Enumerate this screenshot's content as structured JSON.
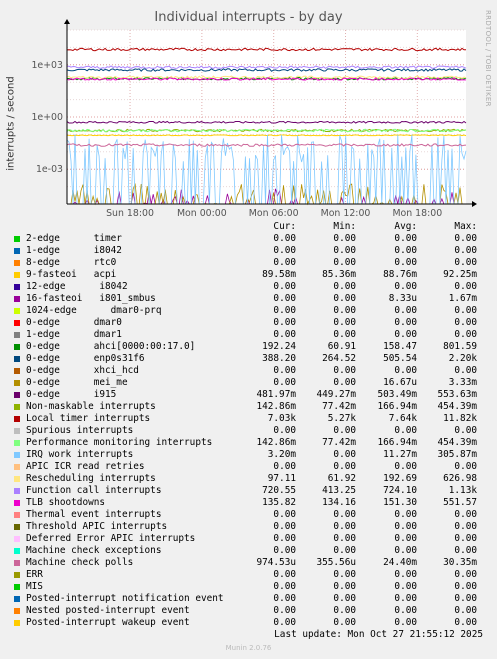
{
  "title": "Individual interrupts - by day",
  "side_text": "RRDTOOL / TOBI OETIKER",
  "ylabel": "interrupts / second",
  "last_update": "Last update: Mon Oct 27 21:55:12 2025",
  "munin_version": "Munin 2.0.76",
  "legend_headers": {
    "cur": "Cur:",
    "min": "Min:",
    "avg": "Avg:",
    "max": "Max:"
  },
  "chart_data": {
    "type": "line",
    "title": "Individual interrupts - by day",
    "ylabel": "interrupts / second",
    "y_scale": "log",
    "ylim": [
      1e-05,
      100000
    ],
    "y_ticks": [
      {
        "value": 1000,
        "label": "1e+03"
      },
      {
        "value": 1,
        "label": "1e+00"
      },
      {
        "value": 0.001,
        "label": "1e-03"
      }
    ],
    "x_ticks": [
      "Sun 18:00",
      "Mon 00:00",
      "Mon 06:00",
      "Mon 12:00",
      "Mon 18:00"
    ],
    "grid": true,
    "series": [
      {
        "name": "2-edge timer",
        "color": "#00cc00",
        "cur": "0.00",
        "min": "0.00",
        "avg": "0.00",
        "max": "0.00"
      },
      {
        "name": "1-edge i8042",
        "color": "#0066b3",
        "cur": "0.00",
        "min": "0.00",
        "avg": "0.00",
        "max": "0.00"
      },
      {
        "name": "8-edge rtc0",
        "color": "#ff8000",
        "cur": "0.00",
        "min": "0.00",
        "avg": "0.00",
        "max": "0.00"
      },
      {
        "name": "9-fasteoi acpi",
        "color": "#ffcc00",
        "cur": "89.58m",
        "min": "85.36m",
        "avg": "88.76m",
        "max": "92.25m"
      },
      {
        "name": "12-edge i8042",
        "color": "#330099",
        "cur": "0.00",
        "min": "0.00",
        "avg": "0.00",
        "max": "0.00"
      },
      {
        "name": "16-fasteoi i801_smbus",
        "color": "#990099",
        "cur": "0.00",
        "min": "0.00",
        "avg": "8.33u",
        "max": "1.67m"
      },
      {
        "name": "1024-edge dmar0-prq",
        "color": "#ccff00",
        "cur": "0.00",
        "min": "0.00",
        "avg": "0.00",
        "max": "0.00"
      },
      {
        "name": "0-edge dmar0",
        "color": "#ff0000",
        "cur": "0.00",
        "min": "0.00",
        "avg": "0.00",
        "max": "0.00"
      },
      {
        "name": "1-edge dmar1",
        "color": "#808080",
        "cur": "0.00",
        "min": "0.00",
        "avg": "0.00",
        "max": "0.00"
      },
      {
        "name": "0-edge ahci[0000:00:17.0]",
        "color": "#008f00",
        "cur": "192.24",
        "min": "60.91",
        "avg": "158.47",
        "max": "801.59"
      },
      {
        "name": "0-edge enp0s31f6",
        "color": "#00487d",
        "cur": "388.20",
        "min": "264.52",
        "avg": "505.54",
        "max": "2.20k"
      },
      {
        "name": "0-edge xhci_hcd",
        "color": "#b35a00",
        "cur": "0.00",
        "min": "0.00",
        "avg": "0.00",
        "max": "0.00"
      },
      {
        "name": "0-edge mei_me",
        "color": "#b38f00",
        "cur": "0.00",
        "min": "0.00",
        "avg": "16.67u",
        "max": "3.33m"
      },
      {
        "name": "0-edge i915",
        "color": "#6b006b",
        "cur": "481.97m",
        "min": "449.27m",
        "avg": "503.49m",
        "max": "553.63m"
      },
      {
        "name": "Non-maskable interrupts",
        "color": "#8fb300",
        "cur": "142.86m",
        "min": "77.42m",
        "avg": "166.94m",
        "max": "454.39m"
      },
      {
        "name": "Local timer interrupts",
        "color": "#b30000",
        "cur": "7.03k",
        "min": "5.27k",
        "avg": "7.64k",
        "max": "11.82k"
      },
      {
        "name": "Spurious interrupts",
        "color": "#bebebe",
        "cur": "0.00",
        "min": "0.00",
        "avg": "0.00",
        "max": "0.00"
      },
      {
        "name": "Performance monitoring interrupts",
        "color": "#80ff80",
        "cur": "142.86m",
        "min": "77.42m",
        "avg": "166.94m",
        "max": "454.39m"
      },
      {
        "name": "IRQ work interrupts",
        "color": "#80c9ff",
        "cur": "3.20m",
        "min": "0.00",
        "avg": "11.27m",
        "max": "305.87m"
      },
      {
        "name": "APIC ICR read retries",
        "color": "#ffc080",
        "cur": "0.00",
        "min": "0.00",
        "avg": "0.00",
        "max": "0.00"
      },
      {
        "name": "Rescheduling interrupts",
        "color": "#ffe680",
        "cur": "97.11",
        "min": "61.92",
        "avg": "192.69",
        "max": "626.98"
      },
      {
        "name": "Function call interrupts",
        "color": "#aa80ff",
        "cur": "720.55",
        "min": "413.25",
        "avg": "724.10",
        "max": "1.13k"
      },
      {
        "name": "TLB shootdowns",
        "color": "#ee00cc",
        "cur": "135.82",
        "min": "134.16",
        "avg": "151.30",
        "max": "551.57"
      },
      {
        "name": "Thermal event interrupts",
        "color": "#ff8080",
        "cur": "0.00",
        "min": "0.00",
        "avg": "0.00",
        "max": "0.00"
      },
      {
        "name": "Threshold APIC interrupts",
        "color": "#666600",
        "cur": "0.00",
        "min": "0.00",
        "avg": "0.00",
        "max": "0.00"
      },
      {
        "name": "Deferred Error APIC interrupts",
        "color": "#ffbfff",
        "cur": "0.00",
        "min": "0.00",
        "avg": "0.00",
        "max": "0.00"
      },
      {
        "name": "Machine check exceptions",
        "color": "#00ffcc",
        "cur": "0.00",
        "min": "0.00",
        "avg": "0.00",
        "max": "0.00"
      },
      {
        "name": "Machine check polls",
        "color": "#cc6699",
        "cur": "974.53u",
        "min": "355.56u",
        "avg": "24.40m",
        "max": "30.35m"
      },
      {
        "name": "ERR",
        "color": "#999900",
        "cur": "0.00",
        "min": "0.00",
        "avg": "0.00",
        "max": "0.00"
      },
      {
        "name": "MIS",
        "color": "#00cc00",
        "cur": "0.00",
        "min": "0.00",
        "avg": "0.00",
        "max": "0.00"
      },
      {
        "name": "Posted-interrupt notification event",
        "color": "#0066b3",
        "cur": "0.00",
        "min": "0.00",
        "avg": "0.00",
        "max": "0.00"
      },
      {
        "name": "Nested posted-interrupt event",
        "color": "#ff8000",
        "cur": "0.00",
        "min": "0.00",
        "avg": "0.00",
        "max": "0.00"
      },
      {
        "name": "Posted-interrupt wakeup event",
        "color": "#ffcc00",
        "cur": "0.00",
        "min": "0.00",
        "avg": "0.00",
        "max": "0.00"
      }
    ]
  },
  "legend_names": [
    "2-edge      timer",
    "1-edge      i8042",
    "8-edge      rtc0",
    "9-fasteoi   acpi",
    "12-edge      i8042",
    "16-fasteoi   i801_smbus",
    "1024-edge      dmar0-prq",
    "0-edge      dmar0",
    "1-edge      dmar1",
    "0-edge      ahci[0000:00:17.0]",
    "0-edge      enp0s31f6",
    "0-edge      xhci_hcd",
    "0-edge      mei_me",
    "0-edge      i915",
    "Non-maskable interrupts",
    "Local timer interrupts",
    "Spurious interrupts",
    "Performance monitoring interrupts",
    "IRQ work interrupts",
    "APIC ICR read retries",
    "Rescheduling interrupts",
    "Function call interrupts",
    "TLB shootdowns",
    "Thermal event interrupts",
    "Threshold APIC interrupts",
    "Deferred Error APIC interrupts",
    "Machine check exceptions",
    "Machine check polls",
    "ERR",
    "MIS",
    "Posted-interrupt notification event",
    "Nested posted-interrupt event",
    "Posted-interrupt wakeup event"
  ]
}
